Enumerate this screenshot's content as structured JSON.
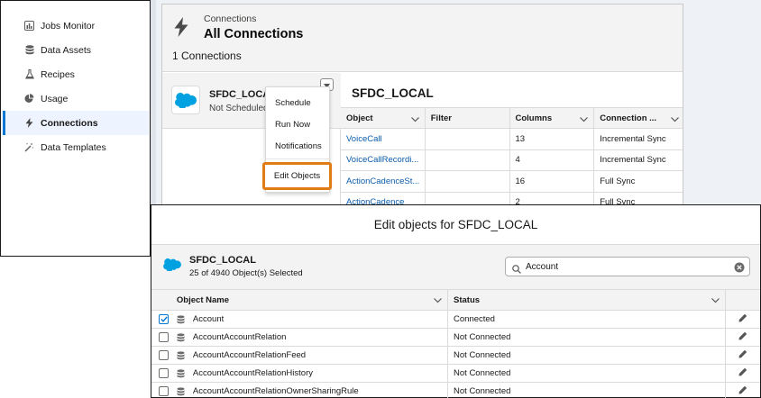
{
  "sidebar": {
    "items": [
      {
        "label": "Jobs Monitor",
        "icon": "bar-chart-icon"
      },
      {
        "label": "Data Assets",
        "icon": "database-icon"
      },
      {
        "label": "Recipes",
        "icon": "flask-icon"
      },
      {
        "label": "Usage",
        "icon": "pie-chart-icon"
      },
      {
        "label": "Connections",
        "icon": "lightning-icon",
        "active": true
      },
      {
        "label": "Data Templates",
        "icon": "magic-wand-icon"
      }
    ]
  },
  "header": {
    "breadcrumb": "Connections",
    "title": "All Connections",
    "count": "1 Connections"
  },
  "connection": {
    "name": "SFDC_LOCAL",
    "schedule": "Not Scheduled"
  },
  "menu": {
    "items": [
      "Schedule",
      "Run Now",
      "Notifications",
      "Edit Objects"
    ]
  },
  "detail": {
    "title": "SFDC_LOCAL",
    "columns": [
      "Object",
      "Filter",
      "Columns",
      "Connection ..."
    ],
    "rows": [
      {
        "object": "VoiceCall",
        "filter": "",
        "columns": "13",
        "mode": "Incremental Sync"
      },
      {
        "object": "VoiceCallRecordi...",
        "filter": "",
        "columns": "4",
        "mode": "Incremental Sync"
      },
      {
        "object": "ActionCadenceSt...",
        "filter": "",
        "columns": "16",
        "mode": "Full Sync"
      },
      {
        "object": "ActionCadence",
        "filter": "",
        "columns": "2",
        "mode": "Full Sync"
      }
    ]
  },
  "modal": {
    "title": "Edit objects for SFDC_LOCAL",
    "connection_name": "SFDC_LOCAL",
    "selected_text": "25 of 4940 Object(s) Selected",
    "search_value": "Account",
    "columns": [
      "Object Name",
      "Status"
    ],
    "rows": [
      {
        "name": "Account",
        "status": "Connected",
        "checked": true
      },
      {
        "name": "AccountAccountRelation",
        "status": "Not Connected",
        "checked": false
      },
      {
        "name": "AccountAccountRelationFeed",
        "status": "Not Connected",
        "checked": false
      },
      {
        "name": "AccountAccountRelationHistory",
        "status": "Not Connected",
        "checked": false
      },
      {
        "name": "AccountAccountRelationOwnerSharingRule",
        "status": "Not Connected",
        "checked": false
      }
    ]
  },
  "colors": {
    "accent": "#0176d3",
    "link": "#0b5cab",
    "highlight": "#e07b16",
    "cloud": "#00a1e0"
  }
}
